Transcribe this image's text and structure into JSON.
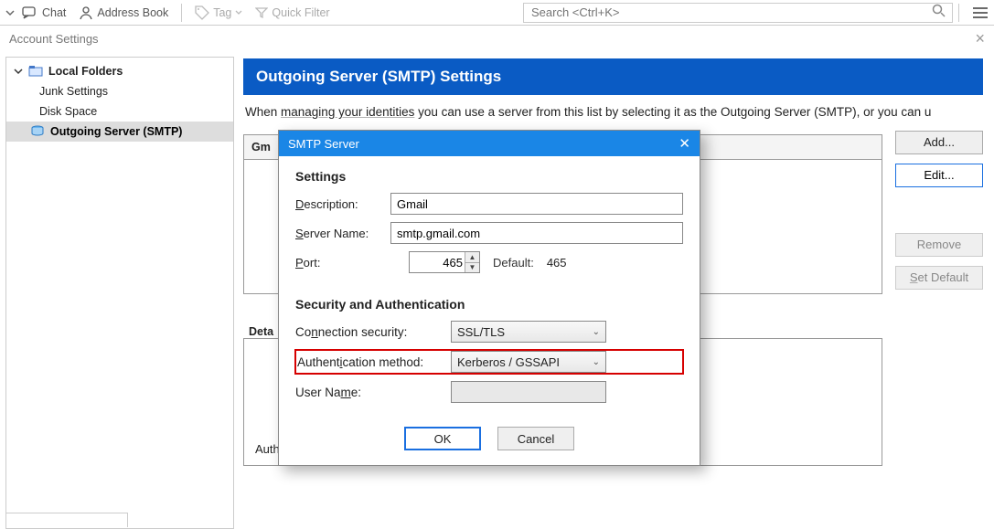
{
  "toolbar": {
    "chat": "Chat",
    "addressbook": "Address Book",
    "tag": "Tag",
    "quickfilter": "Quick Filter",
    "search_placeholder": "Search <Ctrl+K>"
  },
  "acct_bar": {
    "title": "Account Settings"
  },
  "sidebar": {
    "root_label": "Local Folders",
    "items": [
      {
        "label": "Junk Settings"
      },
      {
        "label": "Disk Space"
      },
      {
        "label": "Outgoing Server (SMTP)"
      }
    ]
  },
  "page": {
    "title": "Outgoing Server (SMTP) Settings",
    "desc_prefix": "When ",
    "desc_underlined": "managing your identities",
    "desc_suffix": " you can use a server from this list by selecting it as the Outgoing Server (SMTP), or you can u",
    "server_list_header_short": "Gm",
    "details_label_short": "Deta",
    "details_auth_label": "Auth"
  },
  "buttons": {
    "add": "Add...",
    "edit": "Edit...",
    "remove": "Remove",
    "setdefault": "Set Default"
  },
  "modal": {
    "title": "SMTP Server",
    "settings_label": "Settings",
    "description_label": "Description:",
    "description_value": "Gmail",
    "servername_label": "Server Name:",
    "servername_value": "smtp.gmail.com",
    "port_label": "Port:",
    "port_value": "465",
    "default_label": "Default:",
    "default_value": "465",
    "security_label": "Security and Authentication",
    "connsec_label": "Connection security:",
    "connsec_value": "SSL/TLS",
    "authmethod_label": "Authentication method:",
    "authmethod_value": "Kerberos / GSSAPI",
    "username_label": "User Name:",
    "username_value": "",
    "ok": "OK",
    "cancel": "Cancel"
  }
}
